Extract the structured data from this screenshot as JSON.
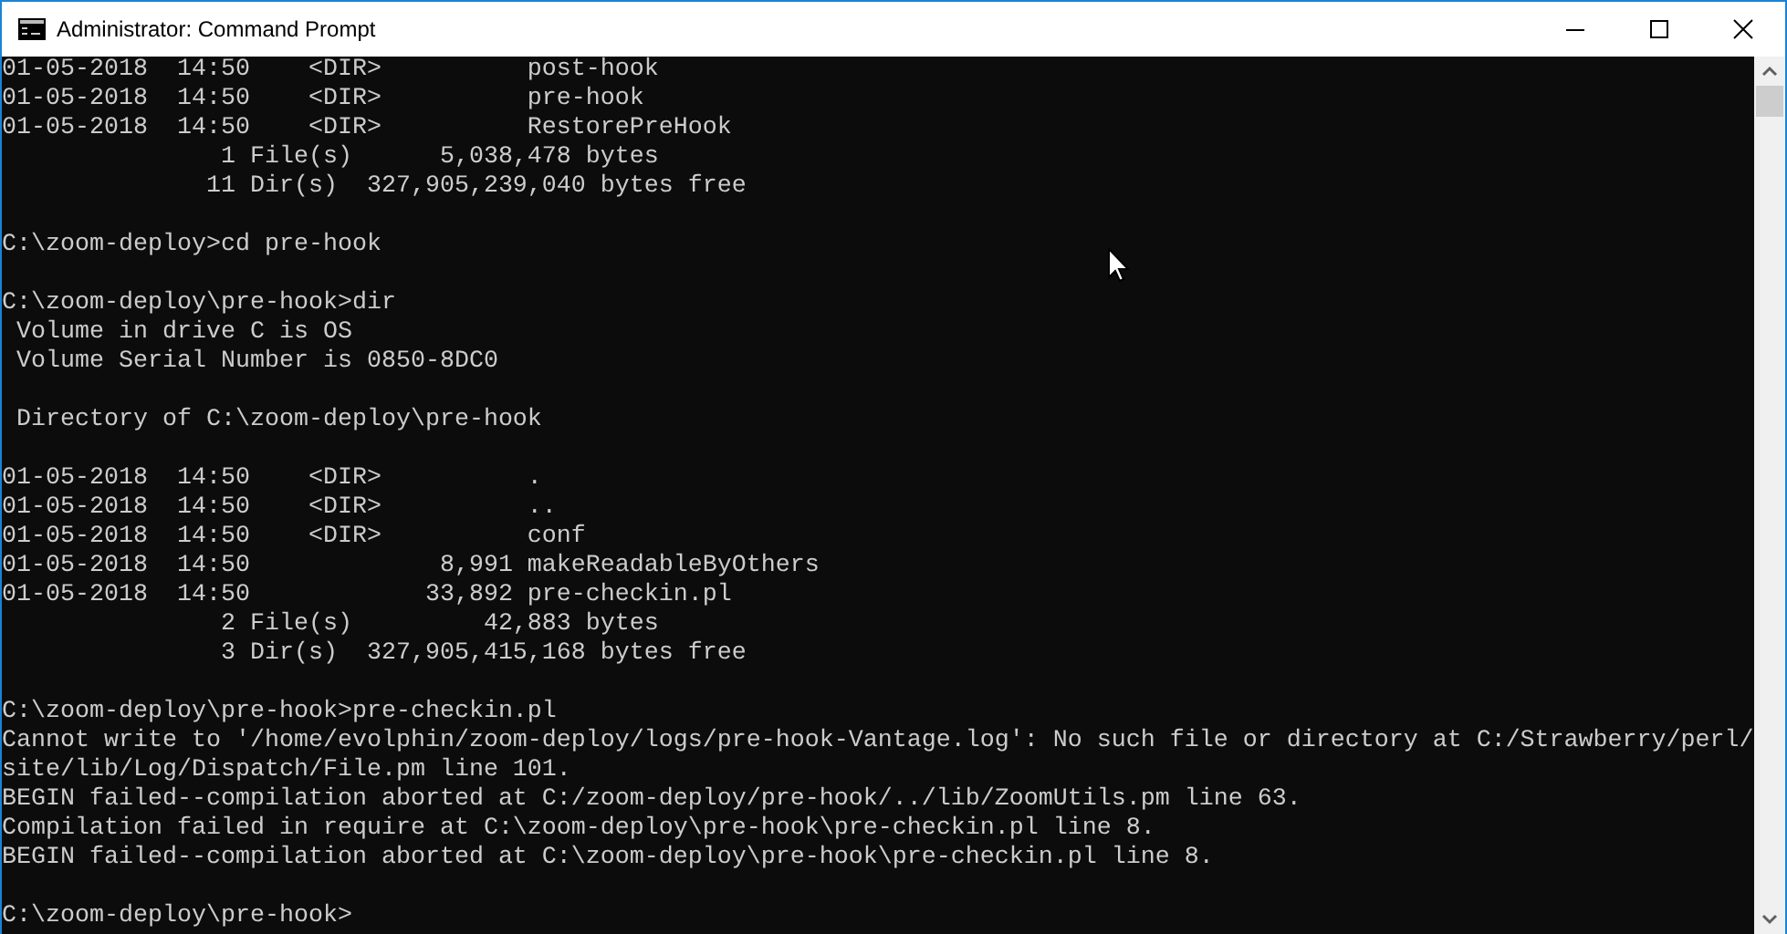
{
  "window": {
    "title": "Administrator: Command Prompt"
  },
  "console": {
    "blocks": [
      [
        "01-05-2018  14:50    <DIR>          post-hook",
        "01-05-2018  14:50    <DIR>          pre-hook",
        "01-05-2018  14:50    <DIR>          RestorePreHook",
        "               1 File(s)      5,038,478 bytes",
        "              11 Dir(s)  327,905,239,040 bytes free"
      ],
      [
        "C:\\zoom-deploy>cd pre-hook"
      ],
      [
        "C:\\zoom-deploy\\pre-hook>dir",
        " Volume in drive C is OS",
        " Volume Serial Number is 0850-8DC0"
      ],
      [
        " Directory of C:\\zoom-deploy\\pre-hook"
      ],
      [
        "01-05-2018  14:50    <DIR>          .",
        "01-05-2018  14:50    <DIR>          ..",
        "01-05-2018  14:50    <DIR>          conf",
        "01-05-2018  14:50             8,991 makeReadableByOthers",
        "01-05-2018  14:50            33,892 pre-checkin.pl",
        "               2 File(s)         42,883 bytes",
        "               3 Dir(s)  327,905,415,168 bytes free"
      ],
      [
        "C:\\zoom-deploy\\pre-hook>pre-checkin.pl",
        "Cannot write to '/home/evolphin/zoom-deploy/logs/pre-hook-Vantage.log': No such file or directory at C:/Strawberry/perl/",
        "site/lib/Log/Dispatch/File.pm line 101.",
        "BEGIN failed--compilation aborted at C:/zoom-deploy/pre-hook/../lib/ZoomUtils.pm line 63.",
        "Compilation failed in require at C:\\zoom-deploy\\pre-hook\\pre-checkin.pl line 8.",
        "BEGIN failed--compilation aborted at C:\\zoom-deploy\\pre-hook\\pre-checkin.pl line 8."
      ],
      [
        "C:\\zoom-deploy\\pre-hook>"
      ]
    ]
  }
}
